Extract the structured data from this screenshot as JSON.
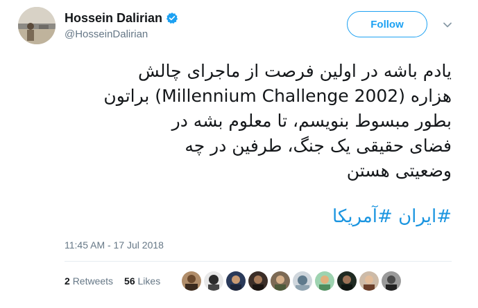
{
  "header": {
    "display_name": "Hossein Dalirian",
    "handle": "@HosseinDalirian",
    "follow_label": "Follow",
    "verified_icon": "verified-badge-icon",
    "menu_icon": "chevron-down-icon"
  },
  "tweet": {
    "lines": [
      "یادم باشه در اولین فرصت از ماجرای چالش",
      "هزاره (Millennium Challenge 2002) براتون",
      "بطور مبسوط بنویسم، تا معلوم بشه در",
      "فضای حقیقی یک جنگ، طرفین در چه",
      "وضعیتی هستن"
    ],
    "hashtags": [
      "#ایران",
      "#آمریکا"
    ],
    "timestamp": "11:45 AM - 17 Jul 2018"
  },
  "stats": {
    "retweets_count": "2",
    "retweets_label": "Retweets",
    "likes_count": "56",
    "likes_label": "Likes"
  },
  "colors": {
    "accent": "#1da1f2",
    "hashtag": "#1b95e0",
    "text": "#14171a",
    "muted": "#657786",
    "divider": "#e6ecf0"
  }
}
